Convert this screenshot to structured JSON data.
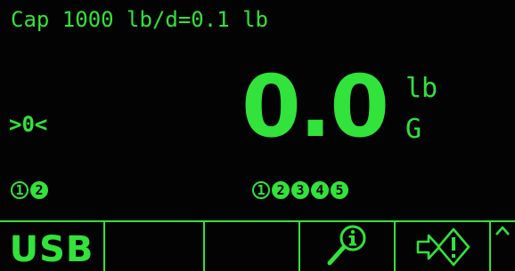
{
  "display": {
    "capacity_line": "Cap 1000 lb/d=0.1 lb",
    "zero_indicator": ">0<",
    "weight": "0.0",
    "unit": "lb",
    "weigh_mode": "G"
  },
  "scale_indicators": [
    "1",
    "2"
  ],
  "range_indicators": [
    "1",
    "2",
    "3",
    "4",
    "5"
  ],
  "softkeys": {
    "usb_label": "USB"
  },
  "colors": {
    "foreground": "#31e33a",
    "background": "#020302"
  },
  "icons": {
    "softkey4": "info-search-icon",
    "softkey5": "target-transfer-icon",
    "softkey6": "chevron-up-icon"
  }
}
